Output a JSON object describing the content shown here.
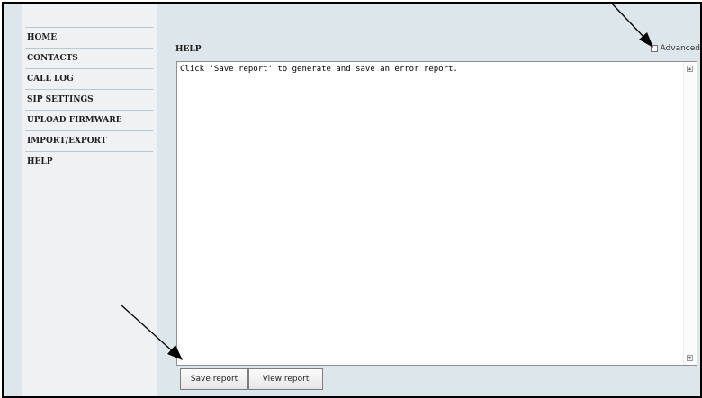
{
  "sidebar": {
    "items": [
      {
        "label": "HOME"
      },
      {
        "label": "CONTACTS"
      },
      {
        "label": "CALL LOG"
      },
      {
        "label": "SIP SETTINGS"
      },
      {
        "label": "UPLOAD FIRMWARE"
      },
      {
        "label": "IMPORT/EXPORT"
      },
      {
        "label": "HELP"
      }
    ]
  },
  "main": {
    "heading": "HELP",
    "advanced_label": "Advanced",
    "advanced_checked": false,
    "textarea_content": "Click 'Save report' to generate and save an error report.",
    "buttons": {
      "save_report": "Save report",
      "view_report": "View report"
    }
  }
}
